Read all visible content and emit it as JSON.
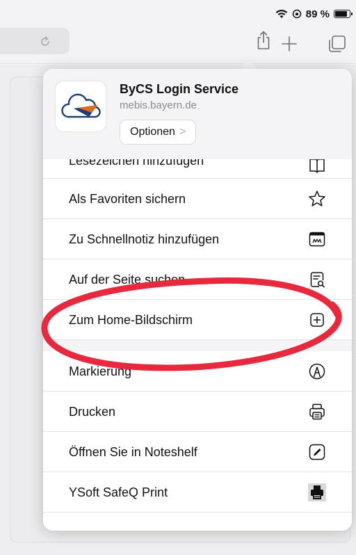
{
  "status_bar": {
    "battery_text": "89 %"
  },
  "toolbar": {
    "reload_icon": "reload-icon",
    "share_icon": "share-icon",
    "new_tab_icon": "plus-icon",
    "tabs_icon": "tabs-icon"
  },
  "share_sheet": {
    "app_title": "ByCS Login Service",
    "domain": "mebis.bayern.de",
    "options_label": "Optionen",
    "options_chevron": ">",
    "items": [
      {
        "label": "Lesezeichen hinzufügen",
        "icon": "book-icon"
      },
      {
        "label": "Als Favoriten sichern",
        "icon": "star-icon"
      },
      {
        "label": "Zu Schnellnotiz hinzufügen",
        "icon": "quick-note-icon"
      },
      {
        "label": "Auf der Seite suchen",
        "icon": "find-on-page-icon"
      },
      {
        "label": "Zum Home-Bildschirm",
        "icon": "add-square-icon"
      },
      {
        "label": "Markierung",
        "icon": "markup-icon"
      },
      {
        "label": "Drucken",
        "icon": "printer-icon"
      },
      {
        "label": "Öffnen Sie in Noteshelf",
        "icon": "noteshelf-icon"
      },
      {
        "label": "YSoft SafeQ Print",
        "icon": "safeq-print-icon"
      }
    ]
  },
  "colors": {
    "annotation": "#e8283c",
    "background": "#f3f3f5",
    "popover": "#ffffff"
  }
}
